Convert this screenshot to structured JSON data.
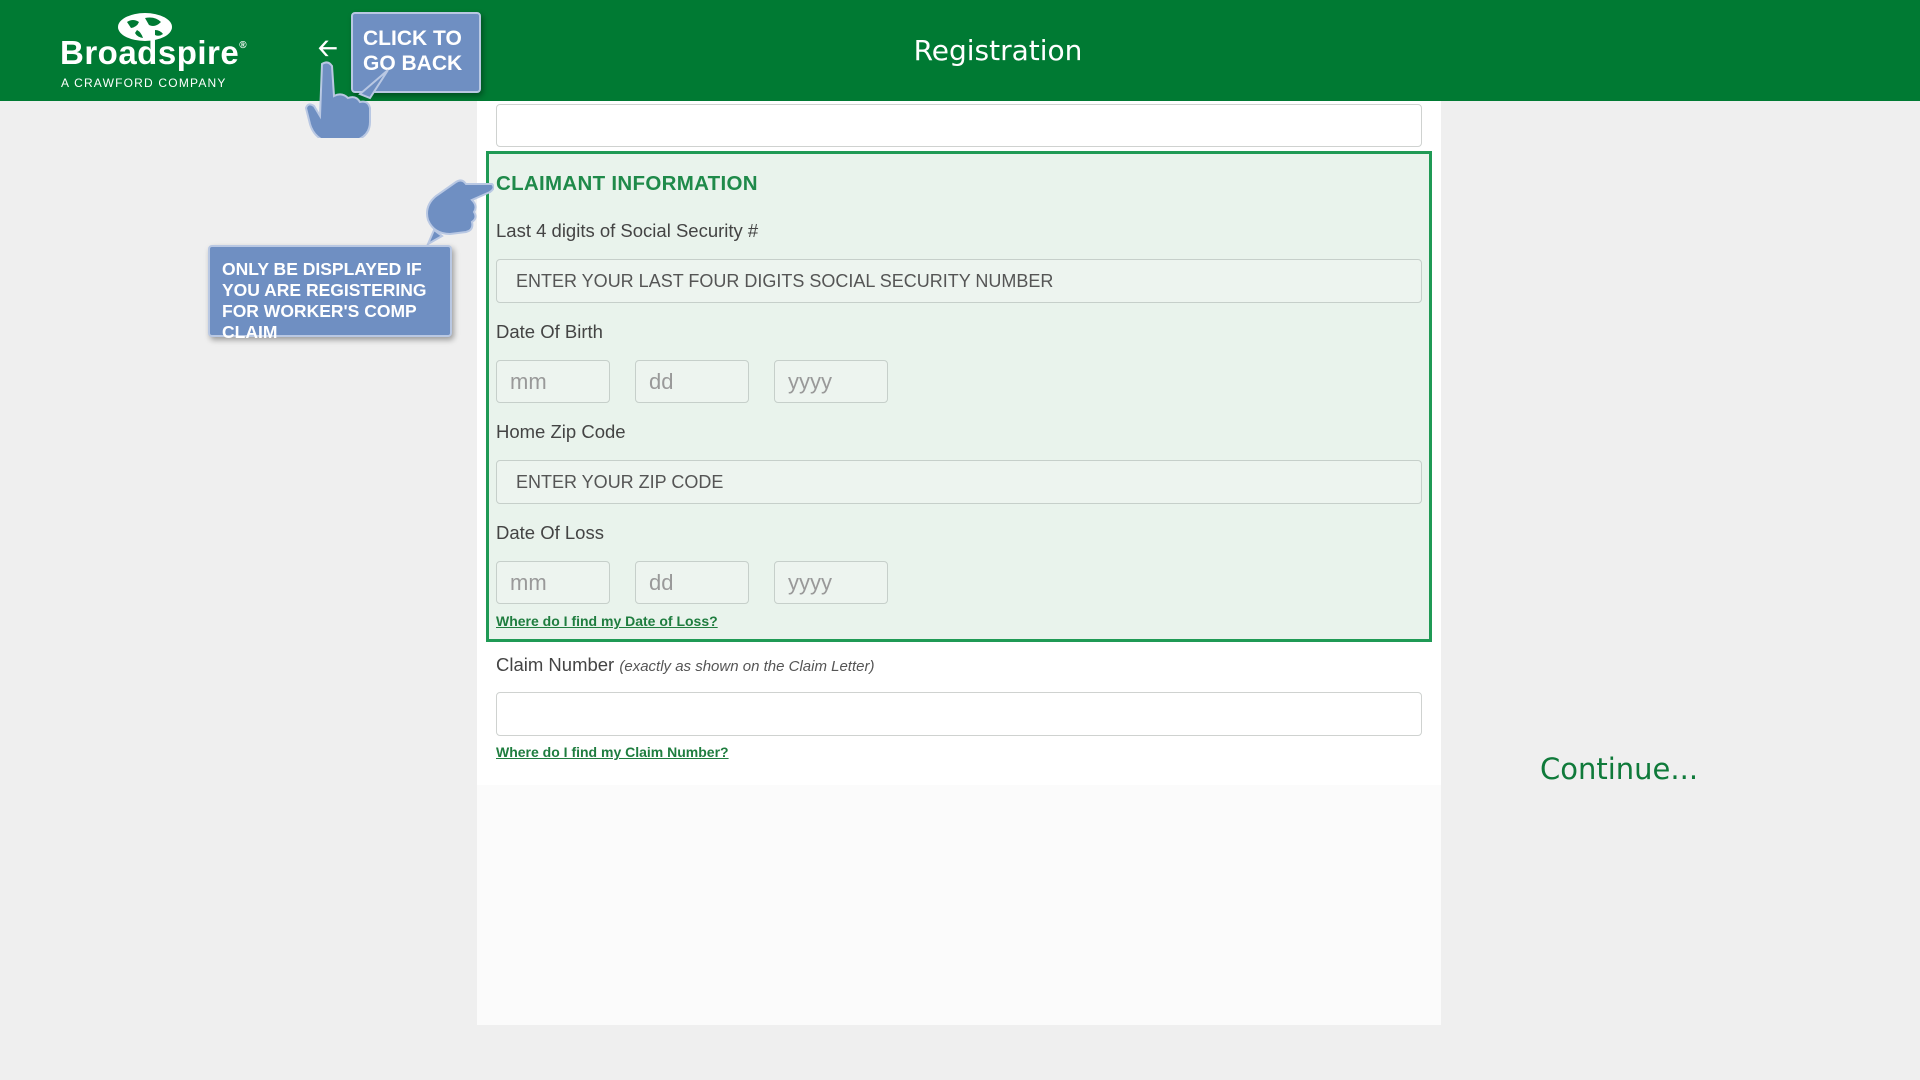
{
  "header": {
    "brand_name": "Broadspire",
    "brand_mark": "®",
    "brand_tagline": "A CRAWFORD COMPANY",
    "title": "Registration",
    "back_icon": "back-arrow-icon",
    "color": "#007a33"
  },
  "callouts": {
    "back": "CLICK TO GO BACK",
    "workers_comp": "ONLY BE DISPLAYED IF YOU ARE REGISTERING FOR WORKER'S COMP CLAIM",
    "color": "#6f8fc2",
    "icon": "pointing-hand-icon"
  },
  "top_field": {
    "value": "",
    "placeholder": ""
  },
  "claimant": {
    "section_title": "CLAIMANT INFORMATION",
    "ssn_label": "Last 4 digits of Social Security #",
    "ssn_placeholder": "ENTER YOUR LAST FOUR DIGITS SOCIAL SECURITY NUMBER",
    "dob_label": "Date Of Birth",
    "dob_mm": "mm",
    "dob_dd": "dd",
    "dob_yyyy": "yyyy",
    "zip_label": "Home Zip Code",
    "zip_placeholder": "ENTER YOUR ZIP CODE",
    "dol_label": "Date Of Loss",
    "dol_mm": "mm",
    "dol_dd": "dd",
    "dol_yyyy": "yyyy",
    "dol_help_link": "Where do I find my Date of Loss?"
  },
  "claim": {
    "label": "Claim Number",
    "label_note": "(exactly as shown on the Claim Letter)",
    "value": "",
    "help_link": "Where do I find my Claim Number?"
  },
  "continue_text": "Continue..."
}
